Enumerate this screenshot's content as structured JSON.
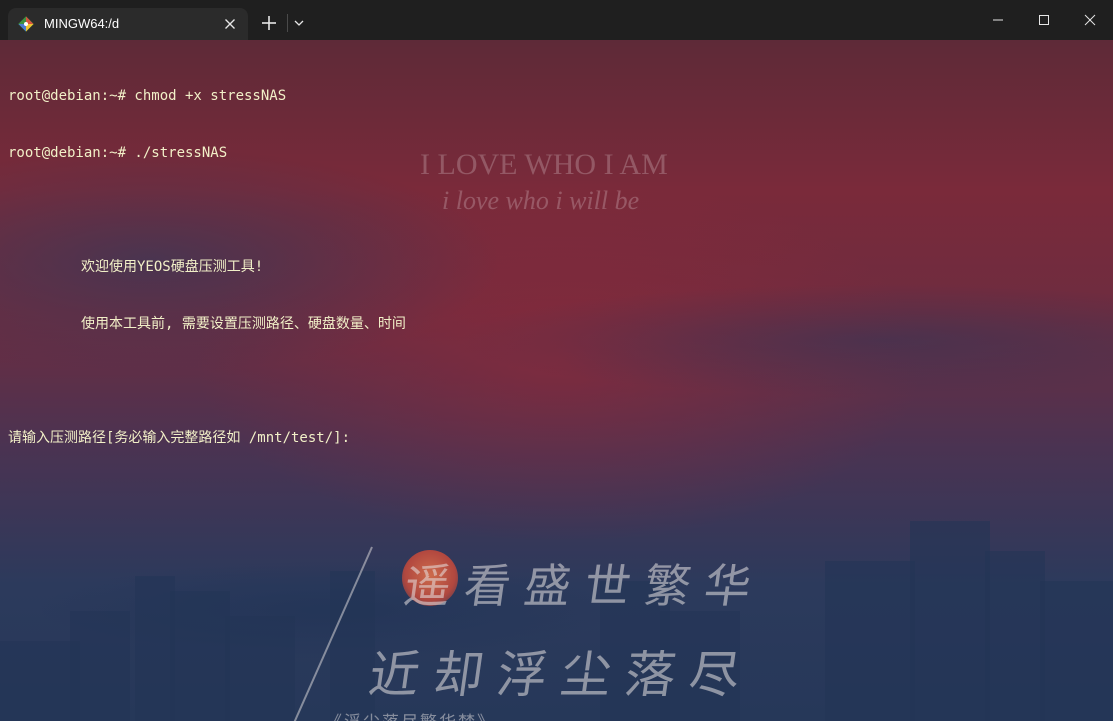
{
  "tab": {
    "title": "MINGW64:/d",
    "icon": "git-bash-icon",
    "close_icon": "close-icon"
  },
  "tabbar": {
    "new_tab_icon": "plus-icon",
    "dropdown_icon": "chevron-down-icon"
  },
  "window_controls": [
    "minimize-icon",
    "maximize-icon",
    "close-icon"
  ],
  "terminal": {
    "lines": [
      "root@debian:~# chmod +x stressNAS",
      "root@debian:~# ./stressNAS",
      "",
      "欢迎使用YEOS硬盘压测工具!",
      "使用本工具前, 需要设置压测路径、硬盘数量、时间",
      "",
      "请输入压测路径[务必输入完整路径如 /mnt/test/]:"
    ],
    "text_color": "#f2f0c8"
  },
  "wallpaper": {
    "headline": "I LOVE WHO I AM",
    "subline": "i love who i will be",
    "poem_line1": "遥看盛世繁华",
    "poem_line2": "近却浮尘落尽",
    "poem_line3": "《浮尘落尽繁华梦》"
  },
  "colors": {
    "tabbar_bg": "#1f1f1f",
    "active_tab_bg": "#2b2b2b",
    "terminal_text": "#f2f0c8"
  }
}
